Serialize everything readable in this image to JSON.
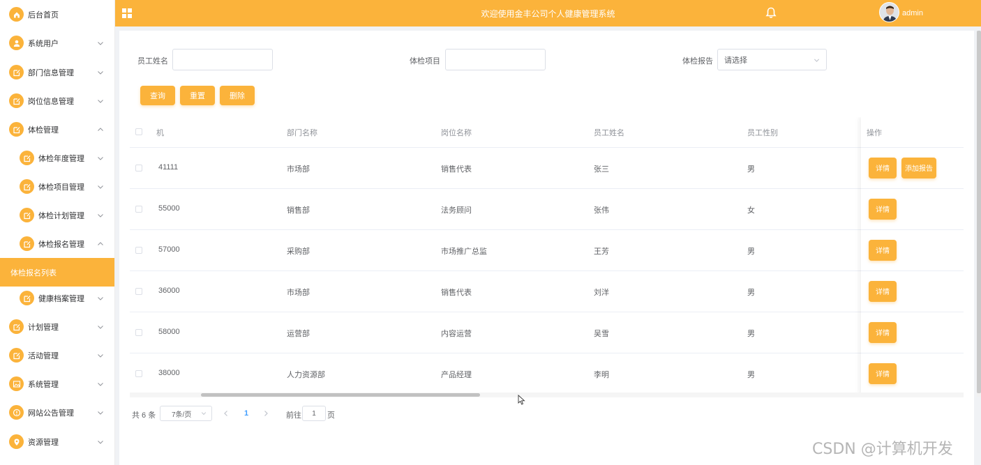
{
  "header": {
    "title": "欢迎使用金丰公司个人健康管理系统",
    "username": "admin"
  },
  "sidebar": {
    "items": [
      {
        "label": "后台首页",
        "icon": "home-icon",
        "level": 0,
        "arrow": ""
      },
      {
        "label": "系统用户",
        "icon": "user-icon",
        "level": 0,
        "arrow": "down"
      },
      {
        "label": "部门信息管理",
        "icon": "edit-icon",
        "level": 0,
        "arrow": "down"
      },
      {
        "label": "岗位信息管理",
        "icon": "edit-icon",
        "level": 0,
        "arrow": "down"
      },
      {
        "label": "体检管理",
        "icon": "edit-icon",
        "level": 0,
        "arrow": "up"
      },
      {
        "label": "体检年度管理",
        "icon": "edit-icon",
        "level": 1,
        "arrow": "down"
      },
      {
        "label": "体检项目管理",
        "icon": "edit-icon",
        "level": 1,
        "arrow": "down"
      },
      {
        "label": "体检计划管理",
        "icon": "edit-icon",
        "level": 1,
        "arrow": "down"
      },
      {
        "label": "体检报名管理",
        "icon": "edit-icon",
        "level": 1,
        "arrow": "up"
      },
      {
        "label": "体检报名列表",
        "icon": "",
        "level": 2,
        "arrow": "",
        "active": true
      },
      {
        "label": "健康档案管理",
        "icon": "edit-icon",
        "level": 1,
        "arrow": "down"
      },
      {
        "label": "计划管理",
        "icon": "edit-icon",
        "level": 0,
        "arrow": "down"
      },
      {
        "label": "活动管理",
        "icon": "edit-icon",
        "level": 0,
        "arrow": "down"
      },
      {
        "label": "系统管理",
        "icon": "image-icon",
        "level": 0,
        "arrow": "down"
      },
      {
        "label": "网站公告管理",
        "icon": "info-icon",
        "level": 0,
        "arrow": "down"
      },
      {
        "label": "资源管理",
        "icon": "location-icon",
        "level": 0,
        "arrow": "down"
      }
    ]
  },
  "filters": {
    "employee_name_label": "员工姓名",
    "employee_name_value": "",
    "item_label": "体检项目",
    "item_value": "",
    "report_label": "体检报告",
    "report_placeholder": "请选择"
  },
  "buttons": {
    "search": "查询",
    "reset": "重置",
    "delete": "删除"
  },
  "table": {
    "columns": [
      "机",
      "部门名称",
      "岗位名称",
      "员工姓名",
      "员工性别",
      "操作"
    ],
    "rows": [
      {
        "id": "41111",
        "dept": "市场部",
        "position": "销售代表",
        "name": "张三",
        "gender": "男",
        "actions": [
          "详情",
          "添加报告"
        ]
      },
      {
        "id": "55000",
        "dept": "销售部",
        "position": "法务顾问",
        "name": "张伟",
        "gender": "女",
        "actions": [
          "详情"
        ]
      },
      {
        "id": "57000",
        "dept": "采购部",
        "position": "市场推广总监",
        "name": "王芳",
        "gender": "男",
        "actions": [
          "详情"
        ]
      },
      {
        "id": "36000",
        "dept": "市场部",
        "position": "销售代表",
        "name": "刘洋",
        "gender": "男",
        "actions": [
          "详情"
        ]
      },
      {
        "id": "58000",
        "dept": "运营部",
        "position": "内容运营",
        "name": "吴雪",
        "gender": "男",
        "actions": [
          "详情"
        ]
      },
      {
        "id": "38000",
        "dept": "人力资源部",
        "position": "产品经理",
        "name": "李明",
        "gender": "男",
        "actions": [
          "详情"
        ]
      }
    ]
  },
  "pagination": {
    "total_text": "共 6 条",
    "page_size": "7条/页",
    "current_page": "1",
    "goto_label": "前往",
    "goto_value": "1",
    "page_suffix": "页"
  },
  "watermark": "CSDN @计算机开发",
  "colors": {
    "accent": "#fbb33b"
  }
}
